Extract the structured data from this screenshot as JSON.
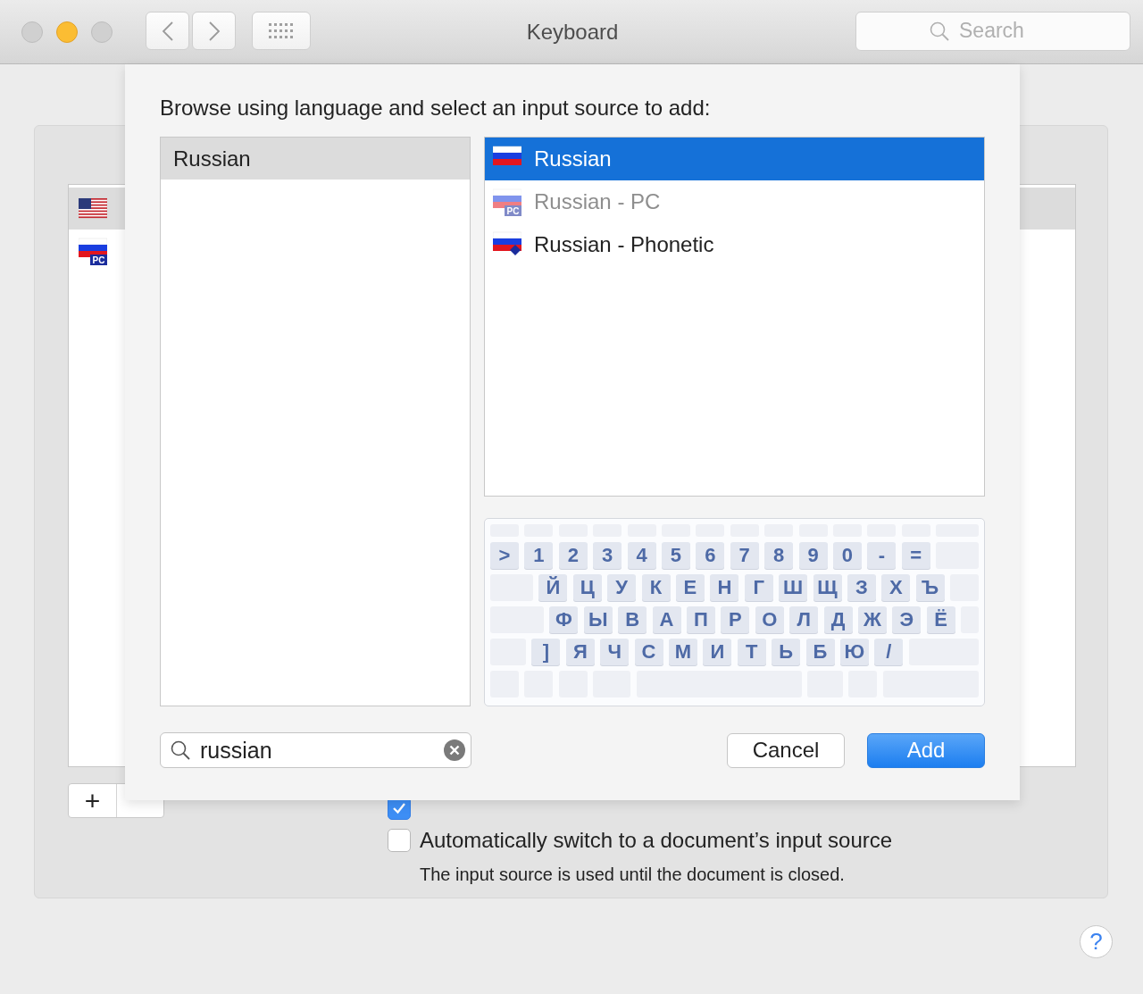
{
  "window": {
    "title": "Keyboard",
    "search_placeholder": "Search"
  },
  "background": {
    "input_sources": [
      {
        "kind": "us",
        "selected": true
      },
      {
        "kind": "ru",
        "badge": "PC",
        "selected": false
      }
    ],
    "add_button": "+",
    "options": [
      {
        "checked": true
      },
      {
        "label": "Automatically switch to a document’s input source",
        "checked": false
      }
    ],
    "note": "The input source is used until the document is closed.",
    "help": "?"
  },
  "sheet": {
    "prompt": "Browse using language and select an input source to add:",
    "languages": [
      {
        "label": "Russian",
        "selected": true
      }
    ],
    "sources": [
      {
        "label": "Russian",
        "kind": "ru",
        "selected": true,
        "disabled": false
      },
      {
        "label": "Russian - PC",
        "kind": "ru",
        "badge": "PC",
        "selected": false,
        "disabled": true
      },
      {
        "label": "Russian - Phonetic",
        "kind": "ru-phonetic",
        "selected": false,
        "disabled": false
      }
    ],
    "keyboard_rows": [
      [
        ">",
        "1",
        "2",
        "3",
        "4",
        "5",
        "6",
        "7",
        "8",
        "9",
        "0",
        "-",
        "="
      ],
      [
        "Й",
        "Ц",
        "У",
        "К",
        "Е",
        "Н",
        "Г",
        "Ш",
        "Щ",
        "З",
        "Х",
        "Ъ"
      ],
      [
        "Ф",
        "Ы",
        "В",
        "А",
        "П",
        "Р",
        "О",
        "Л",
        "Д",
        "Ж",
        "Э",
        "Ё"
      ],
      [
        "]",
        "Я",
        "Ч",
        "С",
        "М",
        "И",
        "Т",
        "Ь",
        "Б",
        "Ю",
        "/"
      ]
    ],
    "search": {
      "value": "russian"
    },
    "buttons": [
      {
        "label": "Cancel",
        "default": false
      },
      {
        "label": "Add",
        "default": true
      }
    ]
  }
}
